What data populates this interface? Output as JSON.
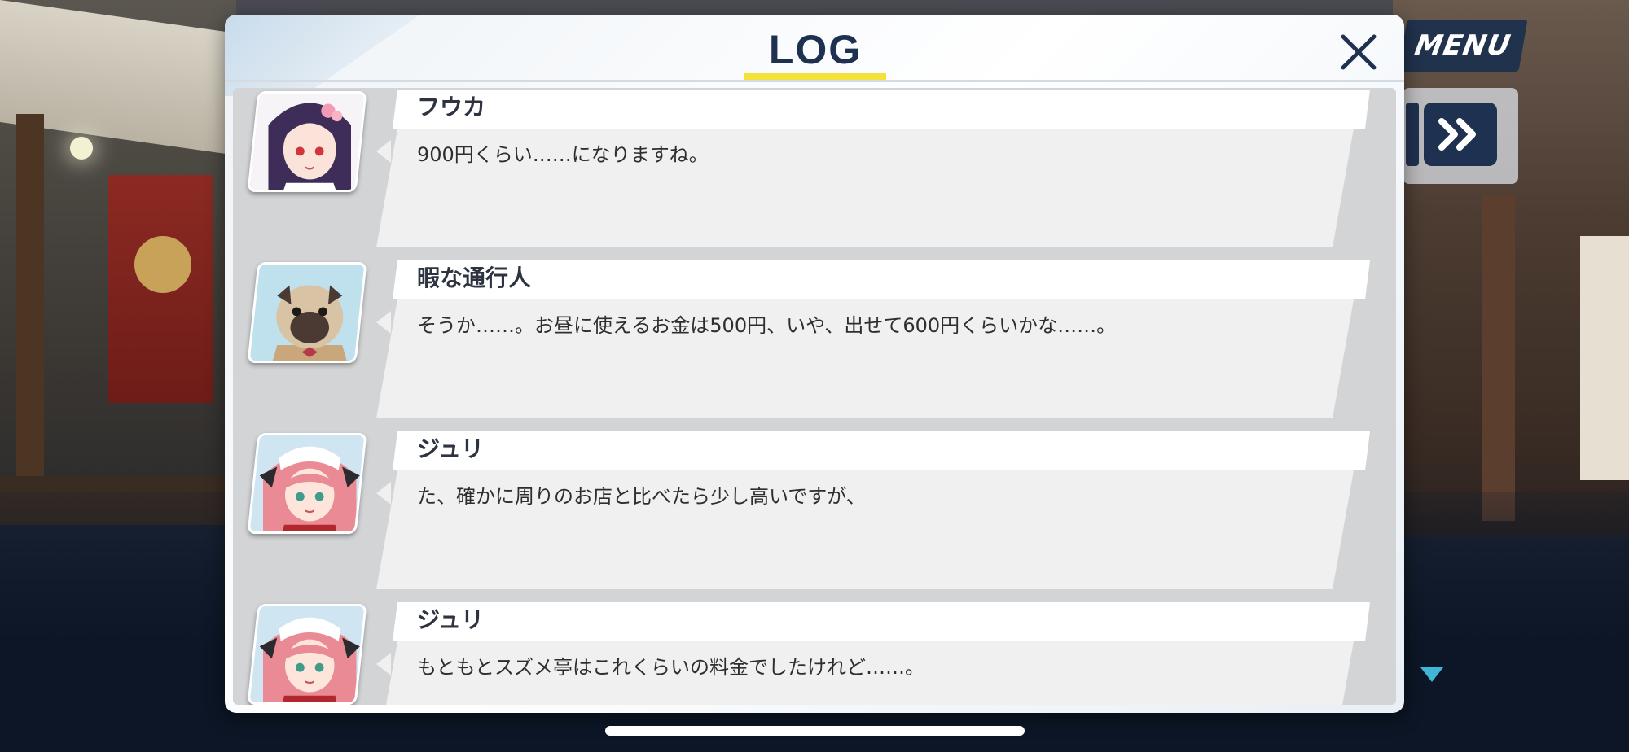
{
  "hud": {
    "menu_label": "MENU",
    "skip_icon": "fast-forward-icon",
    "scroll_indicator_icon": "down-triangle-icon"
  },
  "log": {
    "title": "LOG",
    "close_icon": "close-icon",
    "entries": [
      {
        "speaker": "フウカ",
        "text": "900円くらい……になりますね。",
        "avatar": "fuuka-portrait"
      },
      {
        "speaker": "暇な通行人",
        "text": "そうか……。お昼に使えるお金は500円、いや、出せて600円くらいかな……。",
        "avatar": "pug-portrait"
      },
      {
        "speaker": "ジュリ",
        "text": "た、確かに周りのお店と比べたら少し高いですが、",
        "avatar": "juri-portrait"
      },
      {
        "speaker": "ジュリ",
        "text": "もともとスズメ亭はこれくらいの料金でしたけれど……。",
        "avatar": "juri-portrait"
      }
    ]
  },
  "colors": {
    "accent_navy": "#1f3150",
    "title_underline": "#f4e23a",
    "message_bg": "#f0f0f0",
    "list_bg": "#d3d4d6"
  }
}
